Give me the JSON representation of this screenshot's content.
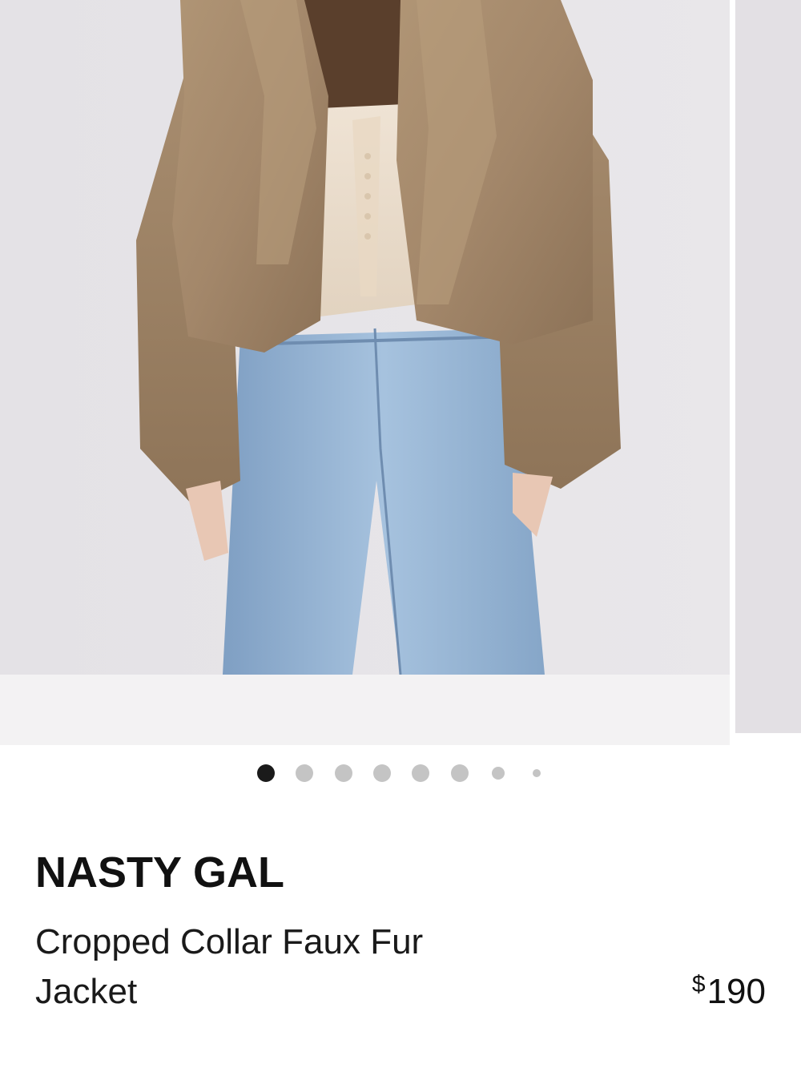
{
  "carousel": {
    "image_alt": "Model wearing a cropped brown faux fur jacket with lace camisole and light blue jeans",
    "total_slides": 8,
    "active_index": 0
  },
  "product": {
    "brand": "NASTY GAL",
    "name": "Cropped Collar Faux Fur Jacket",
    "price_symbol": "$",
    "price_value": "190"
  },
  "colors": {
    "dot_active": "#1a1a1a",
    "dot_inactive": "#c4c4c4",
    "fur": "#a58a6c",
    "denim": "#8fb0d2",
    "background": "#e5e3e7"
  }
}
